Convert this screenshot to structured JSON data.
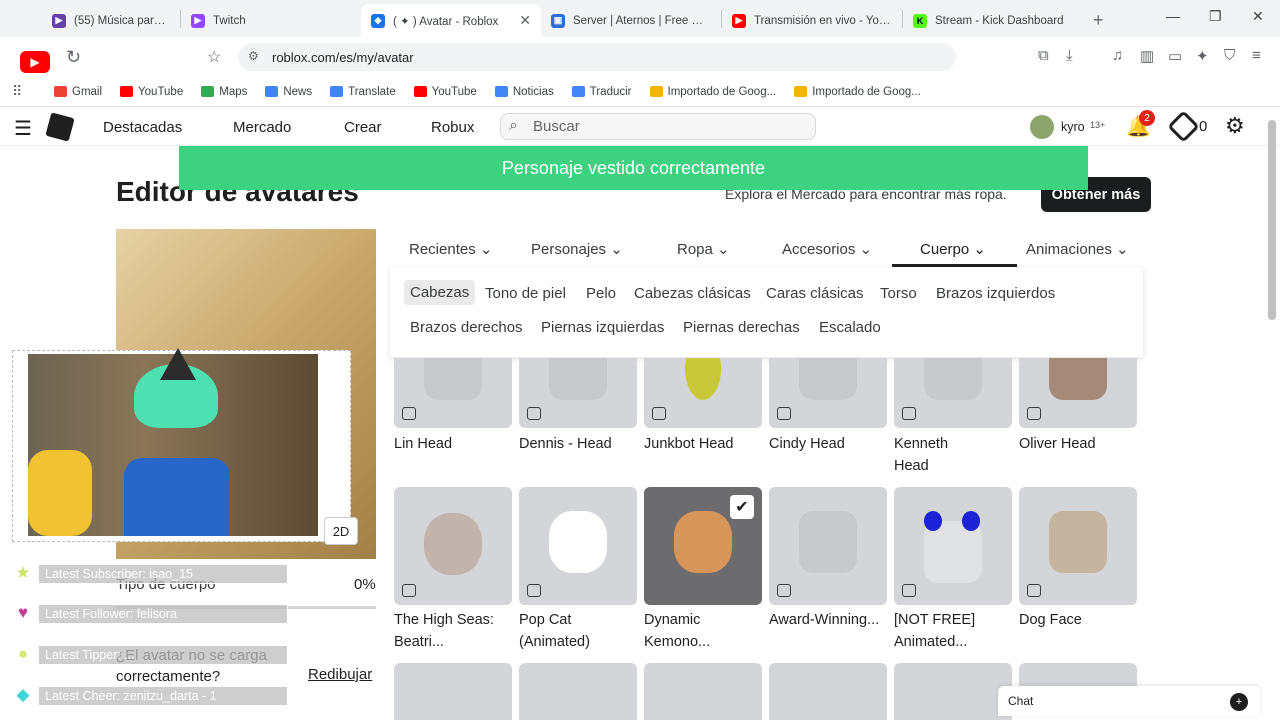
{
  "browser": {
    "tabs": [
      {
        "title": "(55) Música para cocina...",
        "color": "#6441a5",
        "icon": "twitch-icon"
      },
      {
        "title": "Twitch",
        "color": "#9146ff",
        "icon": "twitch-icon"
      },
      {
        "title": "( ✦ ) Avatar - Roblox",
        "color": "#1a73e8",
        "icon": "roblox-icon",
        "active": true
      },
      {
        "title": "Server | Aternos | Free Min...",
        "color": "#2f6cd7",
        "icon": "aternos-icon"
      },
      {
        "title": "Transmisión en vivo - YouT...",
        "color": "#ff0000",
        "icon": "youtube-icon"
      },
      {
        "title": "Stream - Kick Dashboard",
        "color": "#53fc18",
        "icon": "kick-icon"
      }
    ],
    "new_tab": "+",
    "url": "roblox.com/es/my/avatar",
    "bookmarks": [
      {
        "label": "Gmail",
        "color": "#ea4335"
      },
      {
        "label": "YouTube",
        "color": "#ff0000"
      },
      {
        "label": "Maps",
        "color": "#34a853"
      },
      {
        "label": "News",
        "color": "#4285f4"
      },
      {
        "label": "Translate",
        "color": "#4285f4"
      },
      {
        "label": "YouTube",
        "color": "#ff0000"
      },
      {
        "label": "Noticias",
        "color": "#4285f4"
      },
      {
        "label": "Traducir",
        "color": "#4285f4"
      },
      {
        "label": "Importado de Goog...",
        "color": "#f4b400"
      },
      {
        "label": "Importado de Goog...",
        "color": "#f4b400"
      }
    ],
    "brave_badge": "2"
  },
  "roblox_nav": {
    "items": [
      "Destacadas",
      "Mercado",
      "Crear",
      "Robux"
    ],
    "search_placeholder": "Buscar",
    "username": "kyro",
    "age_tag": "13+",
    "notifications": "2",
    "robux": "0"
  },
  "toast": "Personaje vestido correctamente",
  "page": {
    "title": "Editor de avatares",
    "explore_text": "Explora el Mercado para encontrar más ropa.",
    "get_more": "Obtener más",
    "categories": [
      "Recientes",
      "Personajes",
      "Ropa",
      "Accesorios",
      "Cuerpo",
      "Animaciones"
    ],
    "active_category": "Cuerpo",
    "subcategories_row1": [
      "Cabezas",
      "Tono de piel",
      "Pelo",
      "Cabezas clásicas",
      "Caras clásicas",
      "Torso",
      "Brazos izquierdos"
    ],
    "subcategories_row2": [
      "Brazos derechos",
      "Piernas izquierdas",
      "Piernas derechas",
      "Escalado"
    ],
    "active_subcategory": "Cabezas",
    "items_row1": [
      "Lin Head",
      "Dennis - Head",
      "Junkbot Head",
      "Cindy Head",
      "Kenneth Head",
      "Oliver Head"
    ],
    "items_row2": [
      "The High Seas: Beatri...",
      "Pop Cat (Animated)",
      "Dynamic Kemono...",
      "Award-Winning...",
      "[NOT FREE] Animated...",
      "Dog Face"
    ],
    "body_type_label": "Tipo de cuerpo",
    "body_type_value": "0%",
    "not_loading": "¿El avatar no se carga correctamente?",
    "redraw": "Redibujar",
    "view_toggle": "2D"
  },
  "stream_overlay": {
    "latest_subscriber": "Latest Subscriber: isao_15",
    "latest_follower": "Latest Follower: felisora",
    "latest_tipper": "Latest Tipper: ...",
    "latest_cheer": "Latest Cheer: zenitzu_darta - 1"
  },
  "chat": {
    "label": "Chat"
  }
}
